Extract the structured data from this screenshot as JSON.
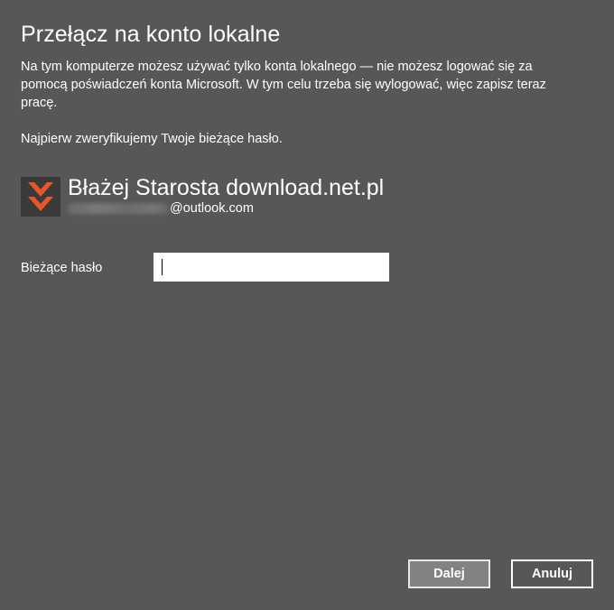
{
  "dialog": {
    "title": "Przełącz na konto lokalne",
    "description": "Na tym komputerze możesz używać tylko konta lokalnego — nie możesz logować się za pomocą poświadczeń konta Microsoft. W tym celu trzeba się wylogować, więc zapisz teraz pracę.",
    "verify_text": "Najpierw zweryfikujemy Twoje bieżące hasło."
  },
  "account": {
    "name": "Błażej Starosta download.net.pl",
    "email_domain": "@outlook.com",
    "avatar_icon": "download-net-chevrons-icon",
    "avatar_color": "#e8572a"
  },
  "password": {
    "label": "Bieżące hasło",
    "value": ""
  },
  "buttons": {
    "next_label": "Dalej",
    "cancel_label": "Anuluj"
  },
  "colors": {
    "background": "#575757",
    "text": "#ffffff"
  }
}
